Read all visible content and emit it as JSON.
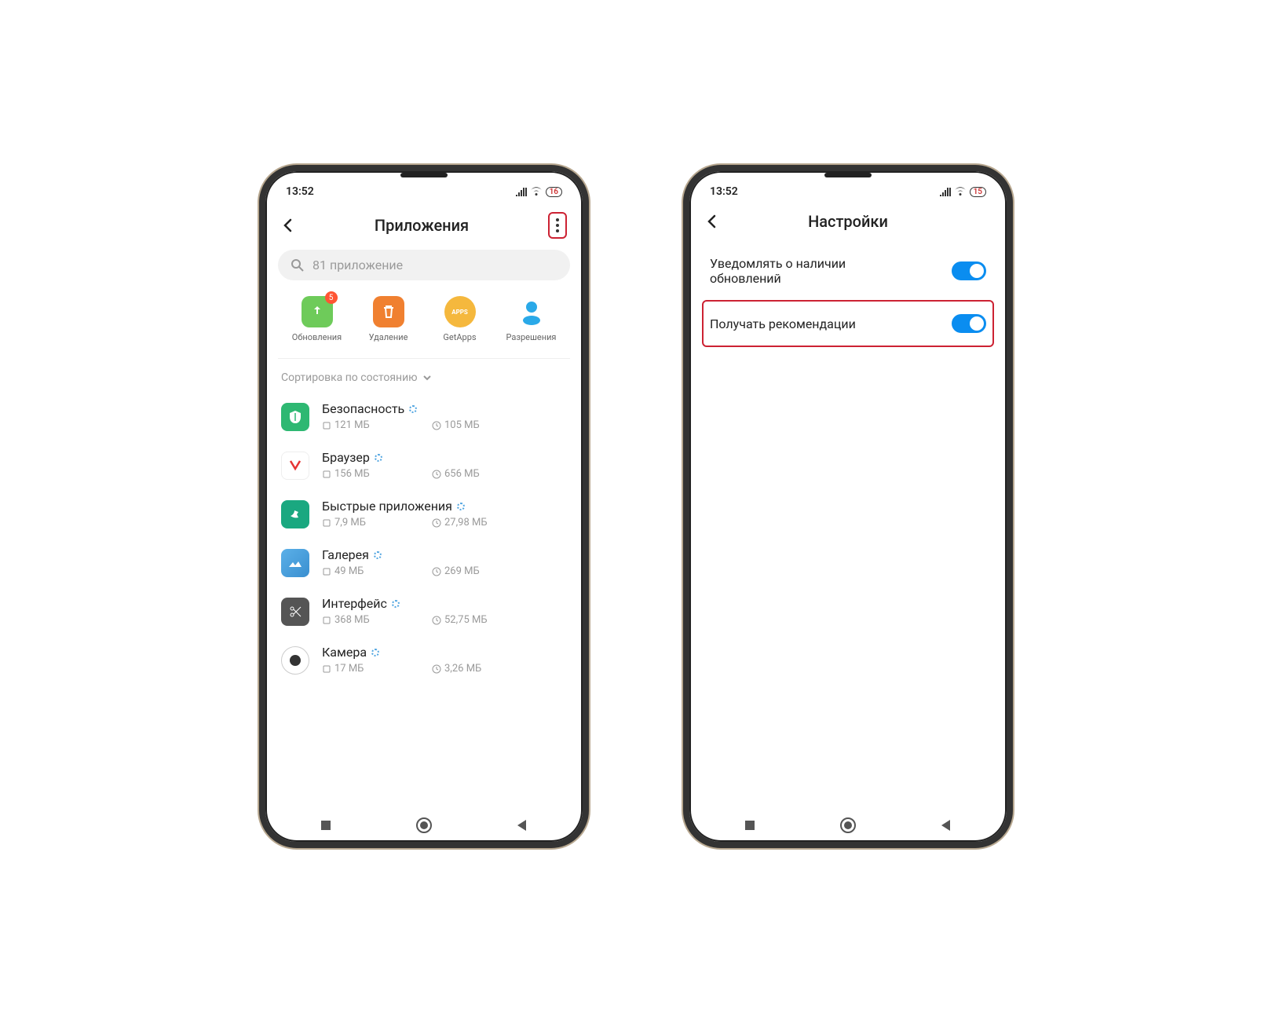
{
  "phone1": {
    "status_time": "13:52",
    "battery": "16",
    "header_title": "Приложения",
    "search_placeholder": "81 приложение",
    "actions": {
      "updates": {
        "label": "Обновления",
        "badge": "5"
      },
      "uninstall": {
        "label": "Удаление"
      },
      "getapps": {
        "label": "GetApps"
      },
      "permissions": {
        "label": "Разрешения"
      }
    },
    "sort_label": "Сортировка по состоянию",
    "apps": [
      {
        "name": "Безопасность",
        "storage": "121 МБ",
        "time": "105 МБ"
      },
      {
        "name": "Браузер",
        "storage": "156 МБ",
        "time": "656 МБ"
      },
      {
        "name": "Быстрые приложения",
        "storage": "7,9 МБ",
        "time": "27,98 МБ"
      },
      {
        "name": "Галерея",
        "storage": "49 МБ",
        "time": "269 МБ"
      },
      {
        "name": "Интерфейс",
        "storage": "368 МБ",
        "time": "52,75 МБ"
      },
      {
        "name": "Камера",
        "storage": "17 МБ",
        "time": "3,26 МБ"
      }
    ]
  },
  "phone2": {
    "status_time": "13:52",
    "battery": "15",
    "header_title": "Настройки",
    "settings": {
      "notify": "Уведомлять о наличии обновлений",
      "recommendations": "Получать рекомендации"
    }
  }
}
